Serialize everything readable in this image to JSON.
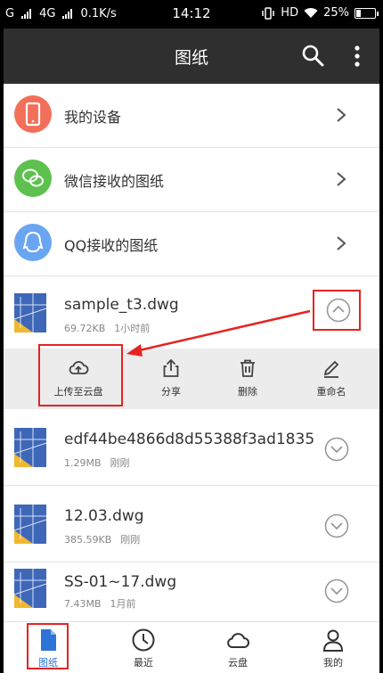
{
  "status_bar": {
    "signal_left": "G",
    "network": "4G",
    "speed": "0.1K/s",
    "time": "14:12",
    "hd": "HD",
    "battery": "25%",
    "battery_level": 0.25
  },
  "app_bar": {
    "title": "图纸"
  },
  "nav_items": [
    {
      "label": "我的设备",
      "icon": "phone-icon",
      "color": "#f26f5a"
    },
    {
      "label": "微信接收的图纸",
      "icon": "wechat-icon",
      "color": "#5ec14f"
    },
    {
      "label": "QQ接收的图纸",
      "icon": "qq-icon",
      "color": "#6aa5f2"
    }
  ],
  "files": [
    {
      "name": "sample_t3.dwg",
      "size": "69.72KB",
      "time": "1小时前",
      "expanded": true
    },
    {
      "name": "edf44be4866d8d55388f3ad1835…",
      "size": "1.29MB",
      "time": "刚刚",
      "expanded": false
    },
    {
      "name": "12.03.dwg",
      "size": "385.59KB",
      "time": "刚刚",
      "expanded": false
    },
    {
      "name": "SS-01~17.dwg",
      "size": "7.43MB",
      "time": "1月前",
      "expanded": false
    }
  ],
  "file_actions": [
    {
      "label": "上传至云盘",
      "icon": "cloud-upload-icon"
    },
    {
      "label": "分享",
      "icon": "share-icon"
    },
    {
      "label": "删除",
      "icon": "trash-icon"
    },
    {
      "label": "重命名",
      "icon": "pencil-icon"
    }
  ],
  "bottom_tabs": [
    {
      "label": "图纸",
      "icon": "document-icon",
      "active": true
    },
    {
      "label": "最近",
      "icon": "clock-icon",
      "active": false
    },
    {
      "label": "云盘",
      "icon": "cloud-icon",
      "active": false
    },
    {
      "label": "我的",
      "icon": "person-icon",
      "active": false
    }
  ],
  "colors": {
    "accent": "#2d74d6",
    "highlight_box": "#e52323",
    "app_bar": "#2f2f2f"
  }
}
